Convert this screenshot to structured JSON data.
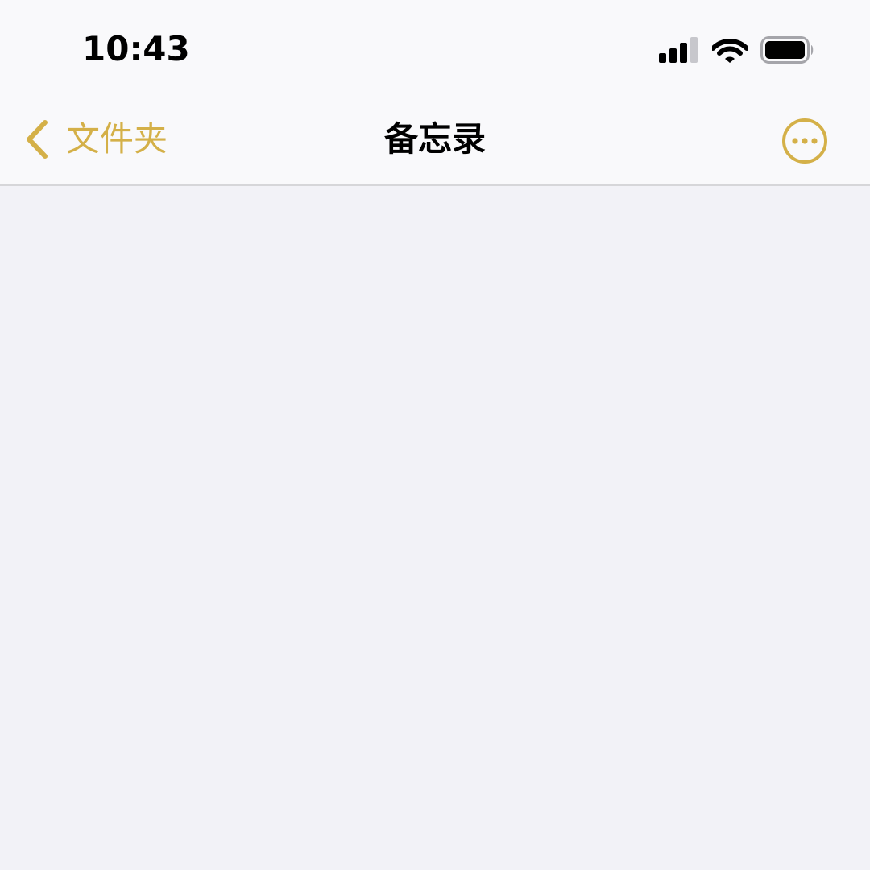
{
  "status_bar": {
    "time": "10:43",
    "signal_icon": "cellular-signal-icon",
    "wifi_icon": "wifi-icon",
    "battery_icon": "battery-icon"
  },
  "nav_bar": {
    "back_label": "文件夹",
    "title": "备忘录",
    "back_icon": "chevron-left-icon",
    "more_icon": "ellipsis-circle-icon"
  },
  "colors": {
    "accent": "#d4b048",
    "background": "#f2f2f7",
    "bar_background": "#f9f9fb"
  }
}
